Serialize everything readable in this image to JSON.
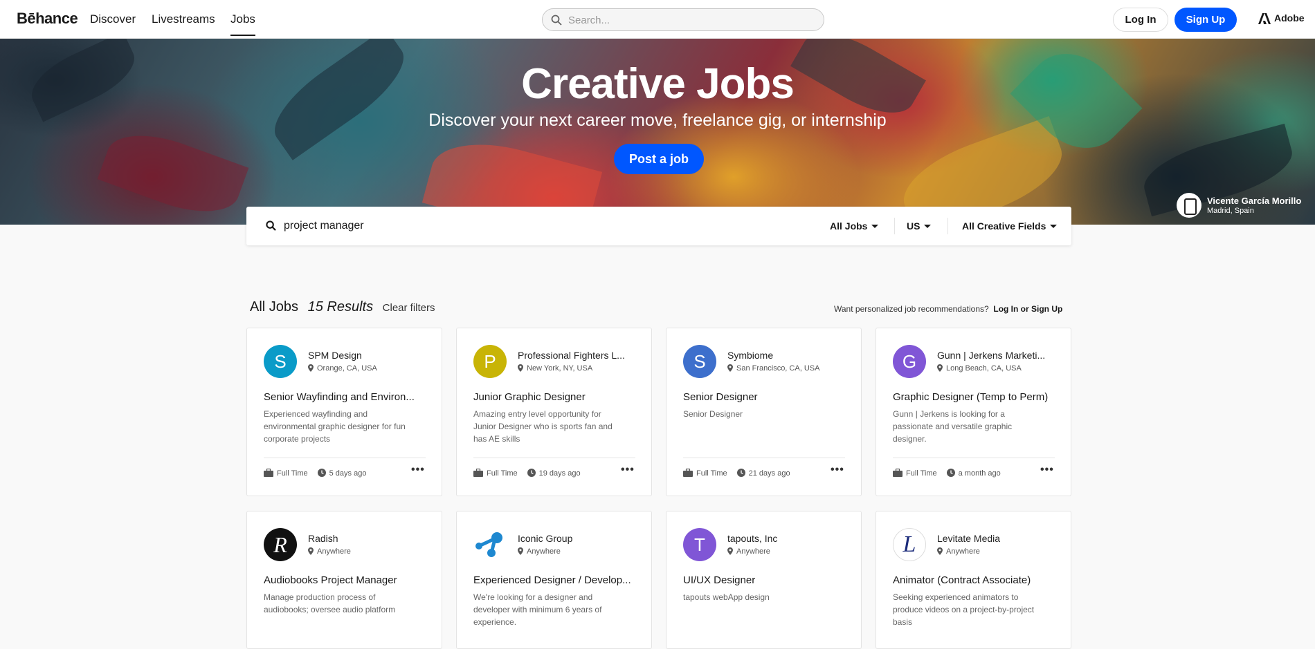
{
  "nav": {
    "logo": "Bēhance",
    "links": [
      "Discover",
      "Livestreams",
      "Jobs"
    ],
    "search_placeholder": "Search...",
    "login": "Log In",
    "signup": "Sign Up",
    "adobe": "Adobe"
  },
  "hero": {
    "title": "Creative Jobs",
    "subtitle": "Discover your next career move, freelance gig, or internship",
    "post_button": "Post a job",
    "credit_name": "Vicente García Morillo",
    "credit_place": "Madrid, Spain"
  },
  "filters": {
    "query": "project manager",
    "job_type": "All Jobs",
    "country": "US",
    "fields": "All Creative Fields"
  },
  "results": {
    "title": "All Jobs",
    "count": "15 Results",
    "clear": "Clear filters",
    "reco_text": "Want personalized job recommendations?",
    "reco_link": "Log In or Sign Up"
  },
  "colors": {
    "accent": "#0057ff"
  },
  "jobs": [
    {
      "initial": "S",
      "color": "#0a9bc8",
      "company": "SPM Design",
      "location": "Orange, CA, USA",
      "title": "Senior Wayfinding and Environ...",
      "desc": "Experienced wayfinding and environmental graphic designer for fun corporate projects",
      "type": "Full Time",
      "posted": "5 days ago"
    },
    {
      "initial": "P",
      "color": "#c8b406",
      "company": "Professional Fighters L...",
      "location": "New York, NY, USA",
      "title": "Junior Graphic Designer",
      "desc": "Amazing entry level opportunity for Junior Designer who is sports fan and has AE skills",
      "type": "Full Time",
      "posted": "19 days ago"
    },
    {
      "initial": "S",
      "color": "#3d6fcc",
      "company": "Symbiome",
      "location": "San Francisco, CA, USA",
      "title": "Senior Designer",
      "desc": "Senior Designer",
      "type": "Full Time",
      "posted": "21 days ago"
    },
    {
      "initial": "G",
      "color": "#8056d6",
      "company": "Gunn | Jerkens Marketi...",
      "location": "Long Beach, CA, USA",
      "title": "Graphic Designer (Temp to Perm)",
      "desc": "Gunn | Jerkens is looking for a passionate and versatile graphic designer.",
      "type": "Full Time",
      "posted": "a month ago"
    },
    {
      "initial": "R",
      "color": "#111111",
      "company": "Radish",
      "location": "Anywhere",
      "title": "Audiobooks Project Manager",
      "desc": "Manage production process of audiobooks; oversee audio platform"
    },
    {
      "initial": "",
      "color": "#ffffff",
      "company": "Iconic Group",
      "location": "Anywhere",
      "title": "Experienced Designer / Develop...",
      "desc": "We're looking for a designer and developer with minimum 6 years of experience."
    },
    {
      "initial": "T",
      "color": "#8056d6",
      "company": "tapouts, Inc",
      "location": "Anywhere",
      "title": "UI/UX Designer",
      "desc": "tapouts webApp design"
    },
    {
      "initial": "L",
      "color": "#ffffff",
      "company": "Levitate Media",
      "location": "Anywhere",
      "title": "Animator (Contract Associate)",
      "desc": "Seeking experienced animators to produce videos on a project-by-project basis"
    }
  ]
}
